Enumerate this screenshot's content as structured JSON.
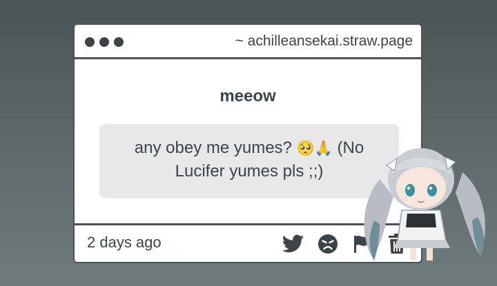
{
  "window": {
    "url": "~ achilleansekai.straw.page"
  },
  "question": {
    "title": "meeow",
    "line1_text": "any obey me yumes?",
    "line1_emojis": "🥺🙏",
    "line1_tail": "(No",
    "line2": "Lucifer yumes pls ;;)"
  },
  "footer": {
    "timestamp": "2 days ago",
    "actions": [
      {
        "icon": "twitter-bird-icon"
      },
      {
        "icon": "angry-face-icon"
      },
      {
        "icon": "flag-icon"
      },
      {
        "icon": "trash-icon"
      }
    ]
  },
  "colors": {
    "text": "#3d4447",
    "border": "#4a5154",
    "bubble": "#e8e8e8"
  }
}
